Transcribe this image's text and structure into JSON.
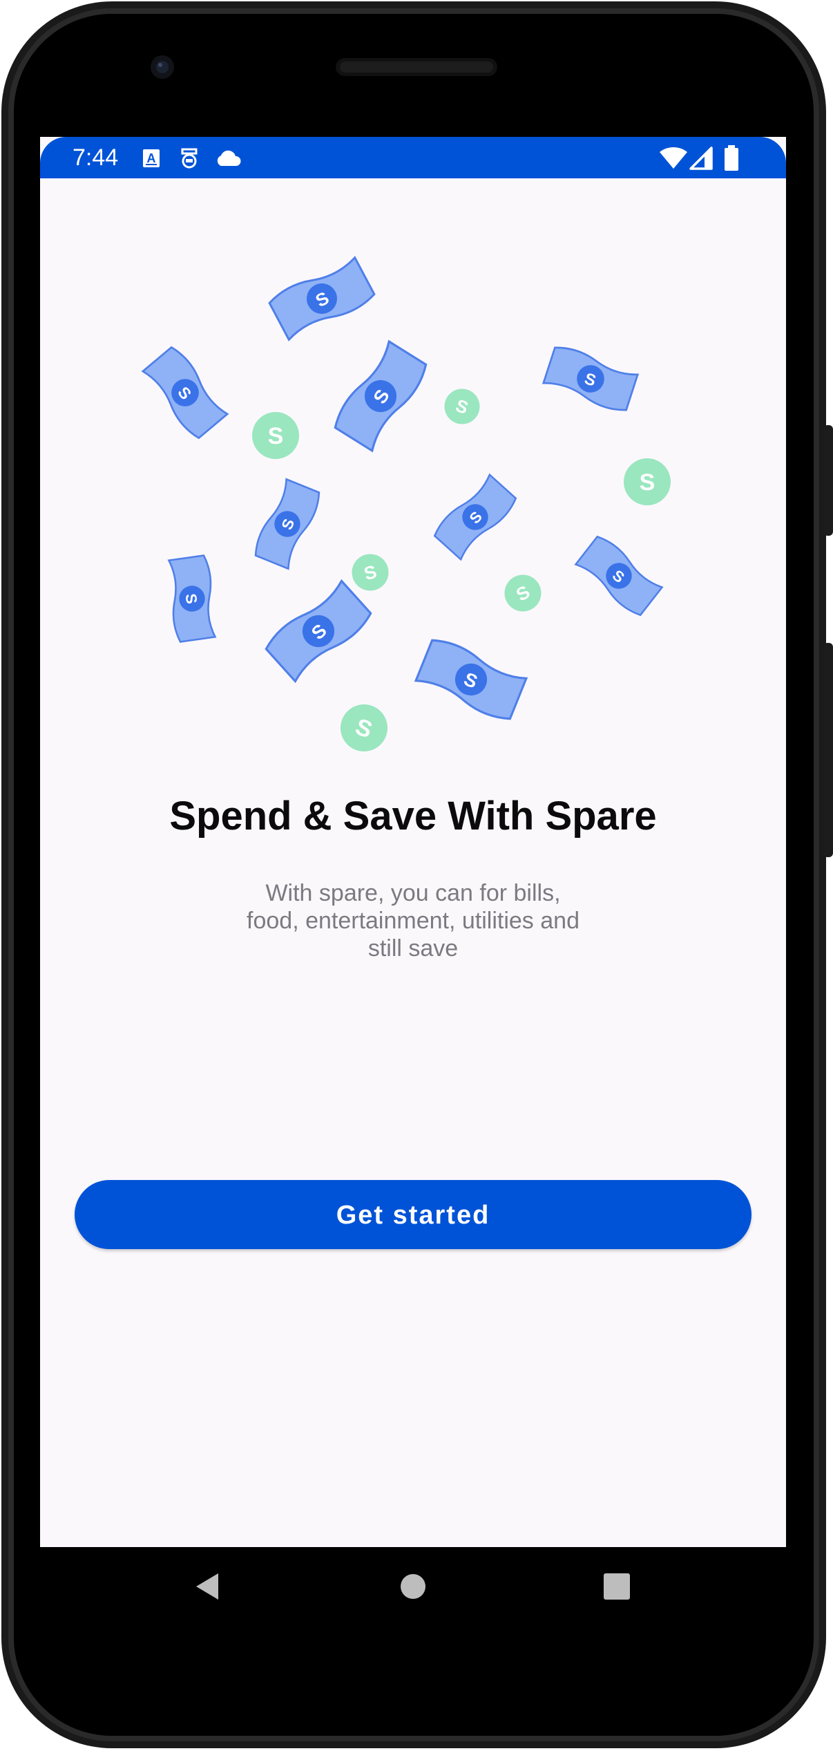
{
  "status_bar": {
    "time": "7:44",
    "left_icons": [
      "text-a-icon",
      "vpn-key-icon",
      "cloud-icon"
    ],
    "right_icons": [
      "wifi-icon",
      "cellular-signal-icon",
      "battery-icon"
    ],
    "color": "#0053d6"
  },
  "onboarding": {
    "title": "Spend & Save With Spare",
    "subtitle": "With spare, you can for bills, food, entertainment, utilities and still save",
    "cta_label": "Get started"
  },
  "colors": {
    "accent": "#0053d6",
    "money_bill": "#8fb2f6",
    "money_coin": "#9ae6bf",
    "background": "#fbf8fc"
  },
  "nav_bar": {
    "buttons": [
      "back-icon",
      "home-icon",
      "recents-icon"
    ]
  }
}
